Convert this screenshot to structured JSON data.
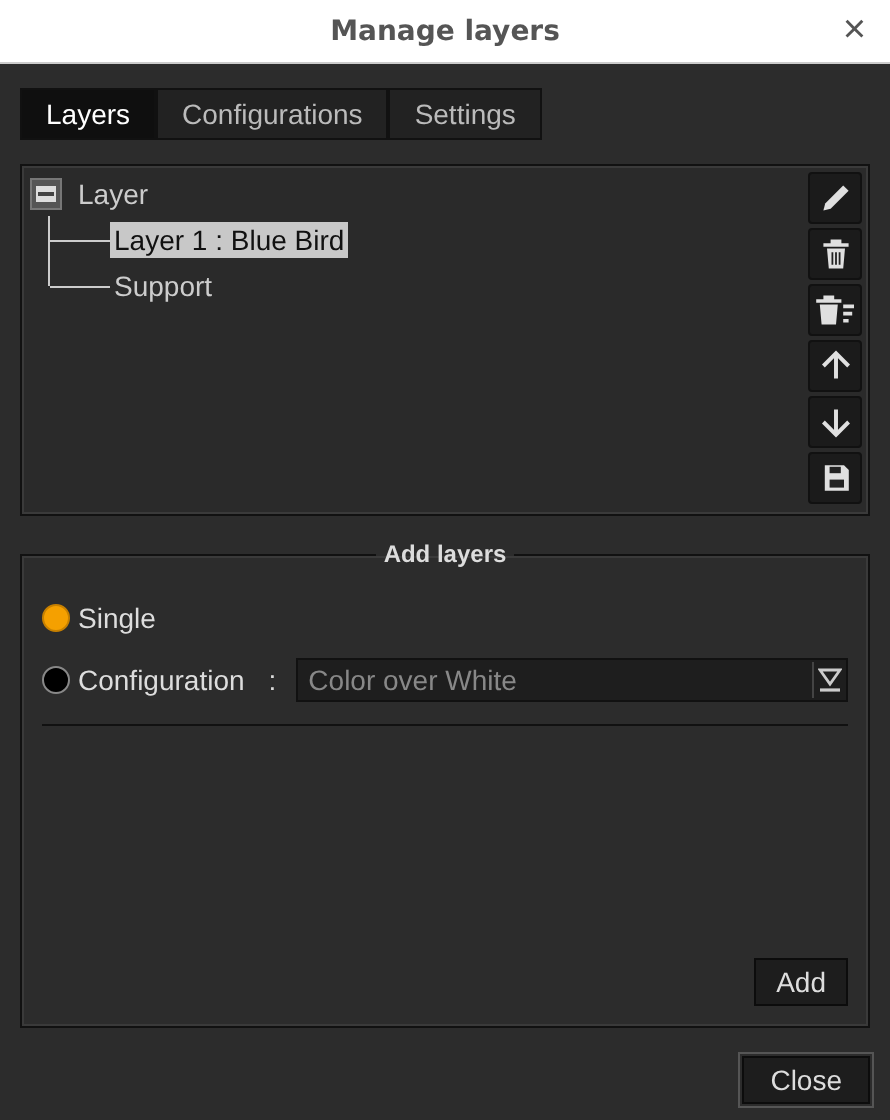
{
  "window": {
    "title": "Manage layers",
    "close": "×"
  },
  "tabs": [
    {
      "label": "Layers",
      "selected": true
    },
    {
      "label": "Configurations",
      "selected": false
    },
    {
      "label": "Settings",
      "selected": false
    }
  ],
  "tree": {
    "label": "Layer",
    "expanded": true,
    "children": [
      {
        "label": "Layer 1 : Blue Bird",
        "selected": true
      },
      {
        "label": "Support",
        "selected": false
      }
    ]
  },
  "tools": [
    {
      "kind": "edit"
    },
    {
      "kind": "delete"
    },
    {
      "kind": "delete-all"
    },
    {
      "kind": "up"
    },
    {
      "kind": "down"
    },
    {
      "kind": "save"
    }
  ],
  "add_layers": {
    "title": "Add layers",
    "options": [
      {
        "label": "Single",
        "selected": true
      },
      {
        "label": "Configuration",
        "selected": false
      }
    ],
    "separator": ":",
    "dropdown": {
      "value": "Color over White"
    },
    "add_button": "Add"
  },
  "buttons": [
    "Close"
  ]
}
